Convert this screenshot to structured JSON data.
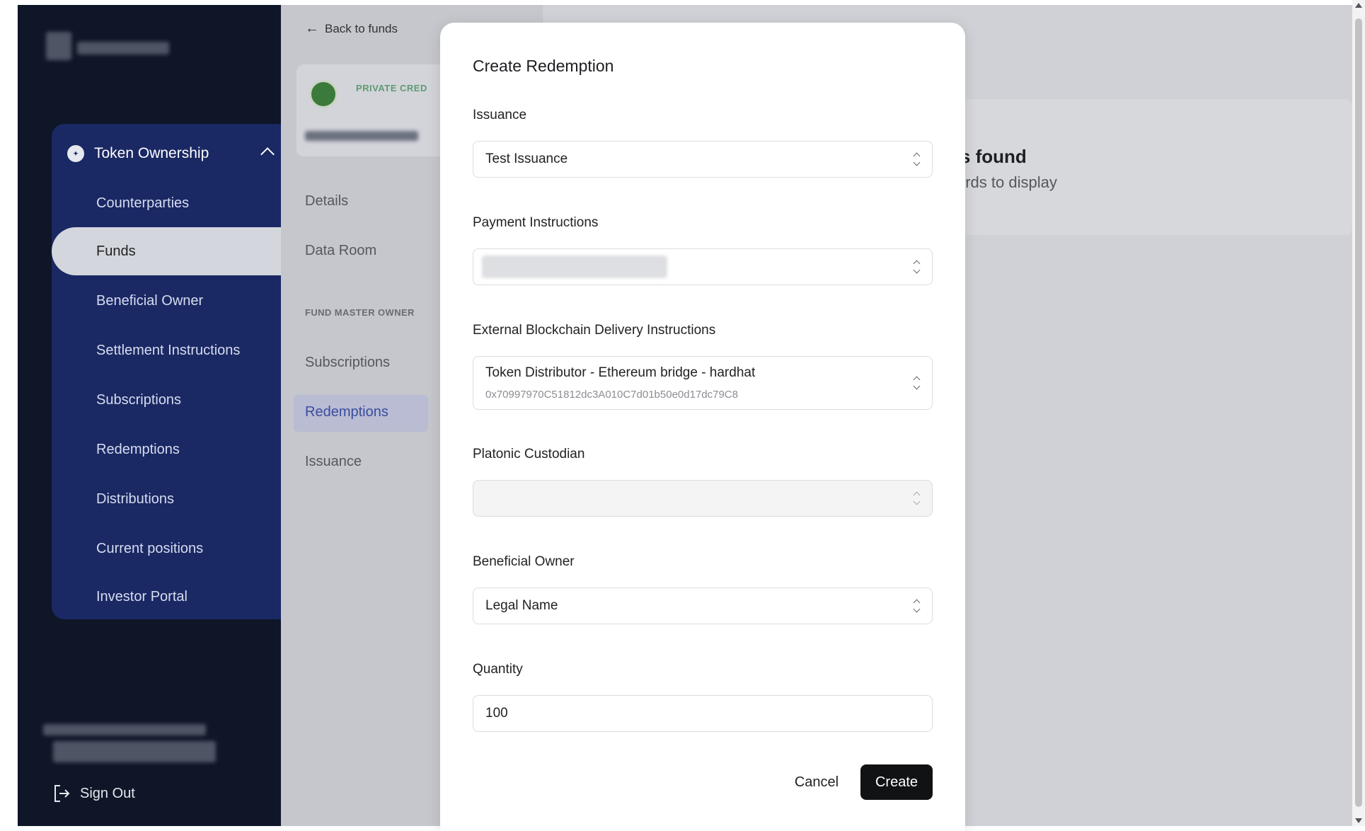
{
  "sidebar": {
    "section_title": "Token Ownership",
    "items": [
      {
        "label": "Counterparties"
      },
      {
        "label": "Funds"
      },
      {
        "label": "Beneficial Owner"
      },
      {
        "label": "Settlement Instructions"
      },
      {
        "label": "Subscriptions"
      },
      {
        "label": "Redemptions"
      },
      {
        "label": "Distributions"
      },
      {
        "label": "Current positions"
      },
      {
        "label": "Investor Portal"
      }
    ],
    "active_item": "Funds",
    "sign_out_label": "Sign Out"
  },
  "fund_panel": {
    "back_label": "Back to funds",
    "badge": "PRIVATE CRED",
    "nav": [
      "Details",
      "Data Room"
    ],
    "section_label": "FUND MASTER OWNER",
    "subnav": [
      "Subscriptions",
      "Redemptions",
      "Issuance"
    ],
    "active_subnav": "Redemptions"
  },
  "background": {
    "empty_title": "ds found",
    "empty_subtitle": "cords to display"
  },
  "modal": {
    "title": "Create Redemption",
    "issuance": {
      "label": "Issuance",
      "value": "Test Issuance"
    },
    "payment_instructions": {
      "label": "Payment Instructions",
      "value": ""
    },
    "delivery": {
      "label": "External Blockchain Delivery Instructions",
      "value": "Token Distributor - Ethereum bridge - hardhat",
      "address": "0x70997970C51812dc3A010C7d01b50e0d17dc79C8"
    },
    "custodian": {
      "label": "Platonic Custodian",
      "value": ""
    },
    "beneficial_owner": {
      "label": "Beneficial Owner",
      "value": "Legal Name"
    },
    "quantity": {
      "label": "Quantity",
      "value": "100"
    },
    "cancel_label": "Cancel",
    "create_label": "Create"
  }
}
